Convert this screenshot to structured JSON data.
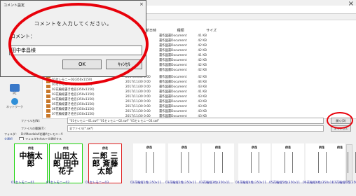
{
  "dialog": {
    "title": "コメント設定",
    "close": "×",
    "message": "コメントを入力してください。",
    "comment_label": "コメント：",
    "comment_value": "田中孝昌様",
    "ok": "OK",
    "cancel": "ｷｬﾝｾﾙ"
  },
  "window": {
    "close": "×"
  },
  "nav": {
    "pc": "PC",
    "network": "ネットワーク"
  },
  "list": {
    "headers": {
      "date": "更新日時",
      "type": "種類",
      "size": "サイズ"
    },
    "rows": [
      {
        "name": "",
        "date": "",
        "type": "書作図書Document",
        "size": "41 KB"
      },
      {
        "name": "",
        "date": "",
        "type": "書作図書Document",
        "size": "42 KB"
      },
      {
        "name": "",
        "date": "",
        "type": "書作図書Document",
        "size": "42 KB"
      },
      {
        "name": "",
        "date": "",
        "type": "書作図書Document",
        "size": "42 KB"
      },
      {
        "name": "",
        "date": "",
        "type": "書作図書Document",
        "size": "41 KB"
      },
      {
        "name": "",
        "date": "",
        "type": "書作図書Document",
        "size": "42 KB"
      },
      {
        "name": "",
        "date": "",
        "type": "書作図書Document",
        "size": "42 KB"
      },
      {
        "name": "",
        "date": "",
        "type": "書作図書Document",
        "size": "42 KB"
      },
      {
        "name": "01セレモニー01(350x1150)",
        "date": "2017/11/30 0:00",
        "type": "書作図書Document",
        "size": "42 KB"
      },
      {
        "name": "01セレモニー02(350x1150)",
        "date": "2017/11/30 0:00",
        "type": "書作図書Document",
        "size": "44 KB"
      },
      {
        "name": "01セレモニー03(350x1150)",
        "date": "2017/11/30 0:00",
        "type": "書作図書Document",
        "size": "43 KB"
      },
      {
        "name": "02花輪縦書き姓名(350x1150)",
        "date": "2017/11/30 0:00",
        "type": "書作図書Document",
        "size": "41 KB"
      },
      {
        "name": "03花輪縦書き姓名(350x1150)",
        "date": "2017/11/30 0:00",
        "type": "書作図書Document",
        "size": "43 KB"
      },
      {
        "name": "04花輪縦書き姓名(350x1150)",
        "date": "2017/11/30 0:00",
        "type": "書作図書Document",
        "size": "43 KB"
      },
      {
        "name": "05花輪縦書き姓名(350x1150)",
        "date": "2017/11/30 0:00",
        "type": "書作図書Document",
        "size": "43 KB"
      },
      {
        "name": "06花輪縦書き姓名(350x1150)",
        "date": "2017/11/30 0:00",
        "type": "書作図書Document",
        "size": "43 KB"
      },
      {
        "name": "07花輪縦書き姓名(350x1150)",
        "date": "2017/11/30 0:00",
        "type": "書作図書Document",
        "size": "43 KB"
      }
    ]
  },
  "form": {
    "filename_label": "ファイル名(N):",
    "filename_value": "\"01セレモニー01.swf\" \"01セレモニー02.swf\" \"01セレモニー03.swf\"",
    "filetype_label": "ファイルの種類(T):",
    "filetype_value": "全ファイル(*.sw*)",
    "open_button": "開く(O)",
    "cancel_button": "キャンセル",
    "folder_label": "フォルダ：",
    "folder_path": "D:¥Mandala¥花輪¥セレモニー¥",
    "select_all": "全選択",
    "subfolder_check": "フォルダを含めて全選択する"
  },
  "thumbnails": [
    {
      "caption": "供花",
      "text": "中楠太郎",
      "name": "01セレモニー01"
    },
    {
      "caption": "供花",
      "text": "山田太郎 田中花子",
      "name": "01セレモニー02"
    },
    {
      "caption": "供花",
      "text": "二郎 三郎 斎藤太郎",
      "name": "01セレモニー03"
    },
    {
      "caption": "供花",
      "text": "",
      "name": "02花輪縦1姓(350x11..."
    },
    {
      "caption": "供花",
      "text": "",
      "name": "03花輪縦2姓(350x11..."
    },
    {
      "caption": "供花",
      "text": "",
      "name": "03花輪縦3姓(350x11..."
    },
    {
      "caption": "供花",
      "text": "",
      "name": "04花輪縦4姓(350x11..."
    },
    {
      "caption": "供花",
      "text": "",
      "name": "05花輪縦5姓(350x11..."
    },
    {
      "caption": "供花",
      "text": "",
      "name": "06花輪縦6姓(350x11..."
    },
    {
      "caption": "供花",
      "text": "",
      "name": "07花輪縦6姓(350x1..."
    }
  ],
  "colors": {
    "highlight_ring": "#e8000a",
    "selected_border": "#1dd40c",
    "alt_selected_border": "#e02020"
  }
}
